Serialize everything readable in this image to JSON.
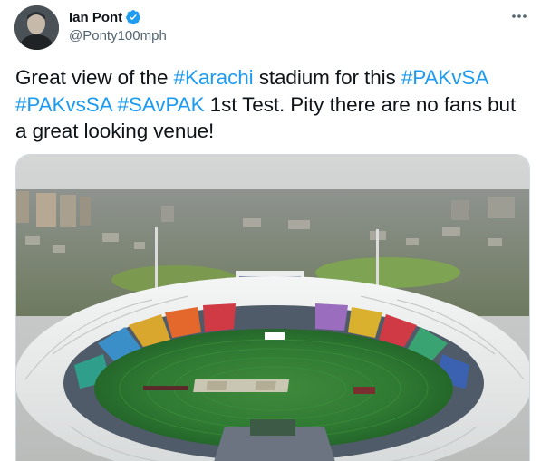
{
  "author": {
    "display_name": "Ian Pont",
    "handle": "@Ponty100mph",
    "verified": true
  },
  "tweet": {
    "text_parts": [
      {
        "type": "text",
        "value": "Great view of the "
      },
      {
        "type": "hashtag",
        "value": "#Karachi"
      },
      {
        "type": "text",
        "value": " stadium for this "
      },
      {
        "type": "hashtag",
        "value": "#PAKvSA"
      },
      {
        "type": "text",
        "value": " "
      },
      {
        "type": "hashtag",
        "value": "#PAKvsSA"
      },
      {
        "type": "text",
        "value": " "
      },
      {
        "type": "hashtag",
        "value": "#SAvPAK"
      },
      {
        "type": "text",
        "value": " 1st Test. Pity there are no fans but a great looking venue!"
      }
    ]
  },
  "media": {
    "icon": "stadium-photo"
  },
  "menu": {
    "icon": "more-horizontal-icon"
  },
  "colors": {
    "accent": "#1d9bf0",
    "text": "#0f1419",
    "secondary": "#536471"
  }
}
